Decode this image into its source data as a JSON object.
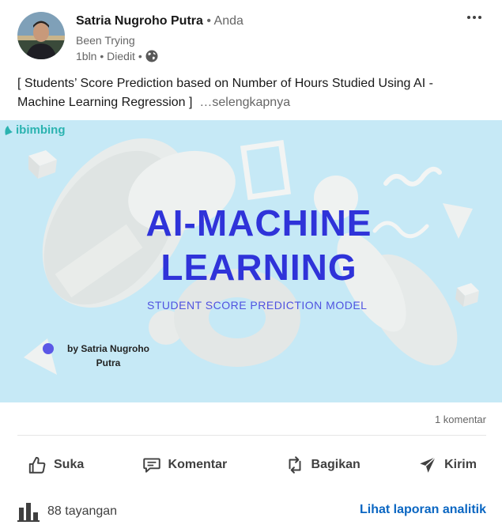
{
  "author": {
    "name": "Satria Nugroho Putra",
    "relation": "• Anda",
    "headline": "Been Trying",
    "time": "1bln • Diedit •",
    "visibility_icon": "globe-icon"
  },
  "menu_icon": "more-horizontal-icon",
  "post": {
    "text": "[ Students’ Score Prediction based on Number of Hours Studied Using AI - Machine Learning Regression ]",
    "see_more": "…selengkapnya"
  },
  "image": {
    "brand": "ibimbing",
    "title_line_1": "AI-MACHINE",
    "title_line_2": "LEARNING",
    "subtitle": "STUDENT SCORE PREDICTION MODEL",
    "byline_1": "by Satria Nugroho",
    "byline_2": "Putra",
    "background_color": "#c6e9f6",
    "title_color": "#2f33d9"
  },
  "stats": {
    "comments": "1 komentar"
  },
  "actions": [
    {
      "label": "Suka",
      "icon": "thumbs-up-icon"
    },
    {
      "label": "Komentar",
      "icon": "comment-icon"
    },
    {
      "label": "Bagikan",
      "icon": "repost-icon"
    },
    {
      "label": "Kirim",
      "icon": "send-icon"
    }
  ],
  "footer": {
    "views": "88 tayangan",
    "views_icon": "bar-chart-icon",
    "analytics_link": "Lihat laporan analitik"
  },
  "colors": {
    "link": "#0a66c2",
    "muted": "#666666"
  }
}
